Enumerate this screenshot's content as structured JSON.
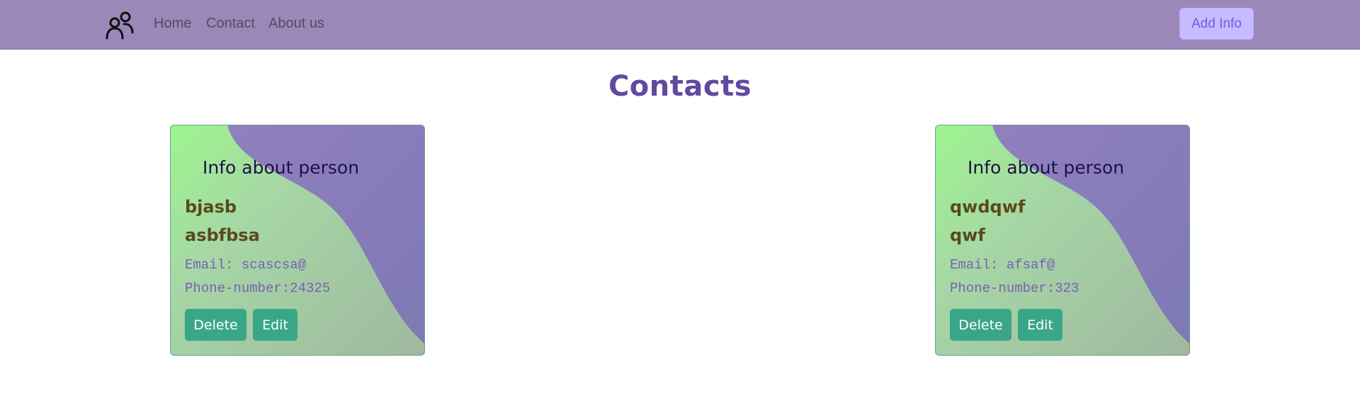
{
  "navbar": {
    "logo_icon": "people-icon",
    "links": [
      {
        "label": "Home"
      },
      {
        "label": "Contact"
      },
      {
        "label": "About us"
      }
    ],
    "add_button_label": "Add Info"
  },
  "page": {
    "title": "Contacts"
  },
  "cards": [
    {
      "heading": "Info about person",
      "first_name": "bjasb",
      "last_name": "asbfbsa",
      "email_line": "Email: scascsa@",
      "phone_line": "Phone-number:24325",
      "delete_label": "Delete",
      "edit_label": "Edit"
    },
    {
      "heading": "Info about person",
      "first_name": "qwdqwf",
      "last_name": "qwf",
      "email_line": "Email: afsaf@",
      "phone_line": "Phone-number:323",
      "delete_label": "Delete",
      "edit_label": "Edit"
    }
  ],
  "colors": {
    "navbar_bg": "#9b88b8",
    "title": "#5f4aa0",
    "button": "#3aa688",
    "add_button_bg": "#c5bcff"
  }
}
